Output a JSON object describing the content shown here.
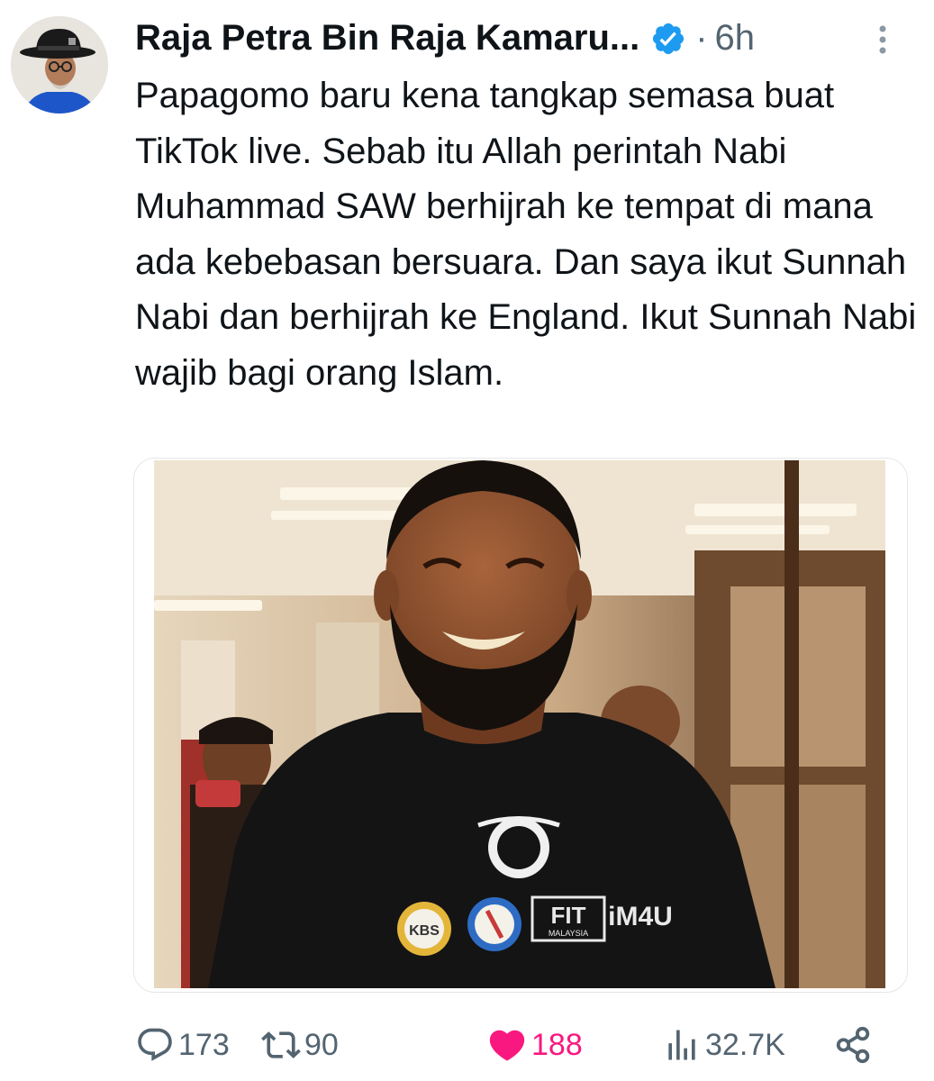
{
  "author": {
    "display_name": "Raja Petra Bin Raja Kamaru...",
    "verified_icon": "verified-badge-icon",
    "separator": "·",
    "time_ago": "6h"
  },
  "tweet": {
    "text": "Papagomo baru kena tangkap semasa buat TikTok live. Sebab itu Allah perintah Nabi Muhammad SAW berhijrah ke tempat di mana ada kebebasan bersuara. Dan saya ikut Sunnah Nabi dan berhijrah ke England. Ikut Sunnah Nabi wajib bagi orang Islam."
  },
  "media": {
    "shirt_texts": {
      "badge_left": "KBS",
      "badge_fit": "FIT",
      "badge_fit_sub": "MALAYSIA",
      "badge_right": "iM4U"
    }
  },
  "actions": {
    "reply_count": "173",
    "retweet_count": "90",
    "like_count": "188",
    "views_count": "32.7K"
  },
  "colors": {
    "like_active": "#f91880",
    "secondary_text": "#536471",
    "verified": "#1d9bf0"
  }
}
